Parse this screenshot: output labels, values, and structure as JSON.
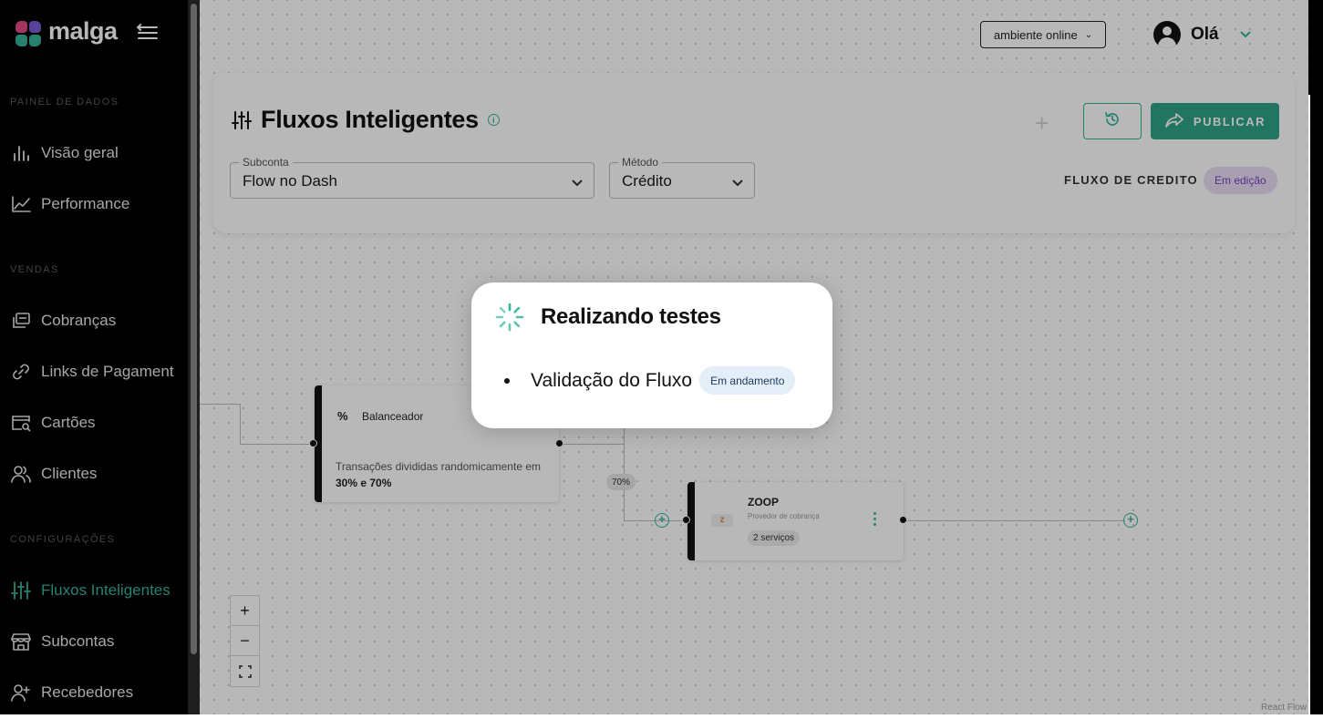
{
  "app": {
    "brand": "malga",
    "colors": {
      "accent": "#35b39a",
      "primary_button": "#2ea287",
      "sidebar_bg": "#000000",
      "edit_badge_bg": "#e9ddf6",
      "status_badge_bg": "#e3eef8"
    }
  },
  "sidebar": {
    "sections": [
      {
        "title": "PAINEL DE DADOS",
        "items": [
          {
            "label": "Visão geral",
            "icon": "bar-chart-icon"
          },
          {
            "label": "Performance",
            "icon": "line-chart-icon"
          }
        ]
      },
      {
        "title": "VENDAS",
        "items": [
          {
            "label": "Cobranças",
            "icon": "charges-icon"
          },
          {
            "label": "Links de Pagament",
            "icon": "link-icon"
          },
          {
            "label": "Cartões",
            "icon": "card-search-icon"
          },
          {
            "label": "Clientes",
            "icon": "users-icon"
          }
        ]
      },
      {
        "title": "CONFIGURAÇÕES",
        "items": [
          {
            "label": "Fluxos Inteligentes",
            "icon": "sliders-icon",
            "active": true
          },
          {
            "label": "Subcontas",
            "icon": "store-icon"
          },
          {
            "label": "Recebedores",
            "icon": "add-user-icon"
          }
        ]
      }
    ]
  },
  "topbar": {
    "environment": "ambiente online",
    "greeting": "Olá"
  },
  "header": {
    "title": "Fluxos Inteligentes",
    "subconta_label": "Subconta",
    "subconta_value": "Flow no Dash",
    "metodo_label": "Método",
    "metodo_value": "Crédito",
    "publish_label": "PUBLICAR",
    "flow_name": "FLUXO DE CREDITO",
    "flow_status": "Em edição"
  },
  "flow": {
    "balancer": {
      "title": "Balanceador",
      "description": "Transações divididas randomicamente em",
      "split": "30% e 70%"
    },
    "edge_label": "70%",
    "provider": {
      "name": "ZOOP",
      "subtitle": "Provedor de cobrança",
      "services": "2 serviços"
    },
    "zoom_in": "+",
    "zoom_out": "−",
    "attribution": "React Flow"
  },
  "modal": {
    "title": "Realizando testes",
    "steps": [
      {
        "label": "Validação do Fluxo",
        "status": "Em andamento"
      }
    ]
  }
}
